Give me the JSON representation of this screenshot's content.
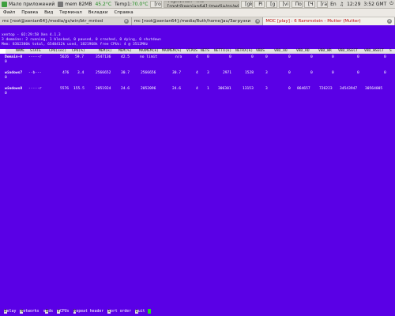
{
  "panel": {
    "apps_menu": "Мало приложений",
    "apps_mem": "mem 82MB",
    "cpu": "45.2°C",
    "temp_label": "Temp1:",
    "temp_value": "70.0°C",
    "tasks": [
      "[ro",
      "[gk",
      "Pi",
      "[g",
      "[vi",
      "По",
      "[Ч",
      "[ra"
    ],
    "active_task": "Терминал - mc [root@xenian64]:/media/gs/win/btr_mnted",
    "clock": "12:29",
    "clock2": "3:52 GMT",
    "lang": "En"
  },
  "menubar": [
    "Файл",
    "Правка",
    "Вид",
    "Терминал",
    "Вкладки",
    "Справка"
  ],
  "tabs": [
    {
      "label": "mc [root@xenian64]:/media/gs/win/btr_mnted"
    },
    {
      "label": "mc [root@xenian64]:/media/Ruth/home/jau/Загрузки"
    },
    {
      "label": "MOC [play] : 6 Rammstein - Mutter (Mutter)"
    }
  ],
  "xentop": {
    "line1": "xentop - 02:29:58   Xen 4.1.3",
    "line2": "3 domains: 2 running, 1 blocked, 0 paused, 0 crashed, 0 dying, 0 shutdown",
    "line3": "Mem: 8362380k total, 6540412k used, 1821968k free    CPUs: 4 @ 3512MHz",
    "columns": [
      "NAME",
      "STATE",
      "CPU(sec)",
      "CPU(%)",
      "MEM(k)",
      "MEM(%)",
      "MAXMEM(k)",
      "MAXMEM(%)",
      "VCPUS",
      "NETS",
      "NETTX(k)",
      "NETRX(k)",
      "VBDS",
      "VBD_OO",
      "VBD_RD",
      "VBD_WR",
      "VBD_RSECT",
      "VBD_WSECT",
      "S"
    ],
    "rows": [
      {
        "name": "Domain-0",
        "state": "-----r",
        "cpu_sec": "5626",
        "cpu_pct": "59.7",
        "mem_k": "3547136",
        "mem_pct": "42.5",
        "maxmem_k": "no limit",
        "maxmem_pct": "n/a",
        "vcpus": "4",
        "nets": "0",
        "nettx": "0",
        "netrx": "0",
        "vbds": "0",
        "vbd_oo": "0",
        "vbd_rd": "0",
        "vbd_wr": "0",
        "vbd_rsect": "0",
        "vbd_wsect": "0",
        "sub": "0"
      },
      {
        "name": "windows7",
        "state": "--b---",
        "cpu_sec": "476",
        "cpu_pct": "3.4",
        "mem_k": "2566652",
        "mem_pct": "30.7",
        "maxmem_k": "2566656",
        "maxmem_pct": "30.7",
        "vcpus": "4",
        "nets": "3",
        "nettx": "2971",
        "netrx": "1528",
        "vbds": "3",
        "vbd_oo": "0",
        "vbd_rd": "0",
        "vbd_wr": "0",
        "vbd_rsect": "0",
        "vbd_wsect": "0",
        "sub": "0"
      },
      {
        "name": "windows8",
        "state": "-----r",
        "cpu_sec": "5576",
        "cpu_pct": "155.5",
        "mem_k": "2051924",
        "mem_pct": "24.6",
        "maxmem_k": "2052096",
        "maxmem_pct": "24.6",
        "vcpus": "4",
        "nets": "1",
        "nettx": "306301",
        "netrx": "13153",
        "vbds": "3",
        "vbd_oo": "0",
        "vbd_rd": "864657",
        "vbd_wr": "726223",
        "vbd_rsect": "34543947",
        "vbd_wsect": "30564005",
        "sub": "0"
      }
    ]
  },
  "fkeys": [
    {
      "key": "D",
      "label": "elay"
    },
    {
      "key": "N",
      "label": "etworks"
    },
    {
      "key": "v",
      "label": "B",
      "after": "ds"
    },
    {
      "key": "V",
      "label": "CPUs"
    },
    {
      "key": "R",
      "label": "epeat header"
    },
    {
      "key": "S",
      "label": "ort order"
    },
    {
      "key": "Q",
      "label": "uit"
    }
  ]
}
